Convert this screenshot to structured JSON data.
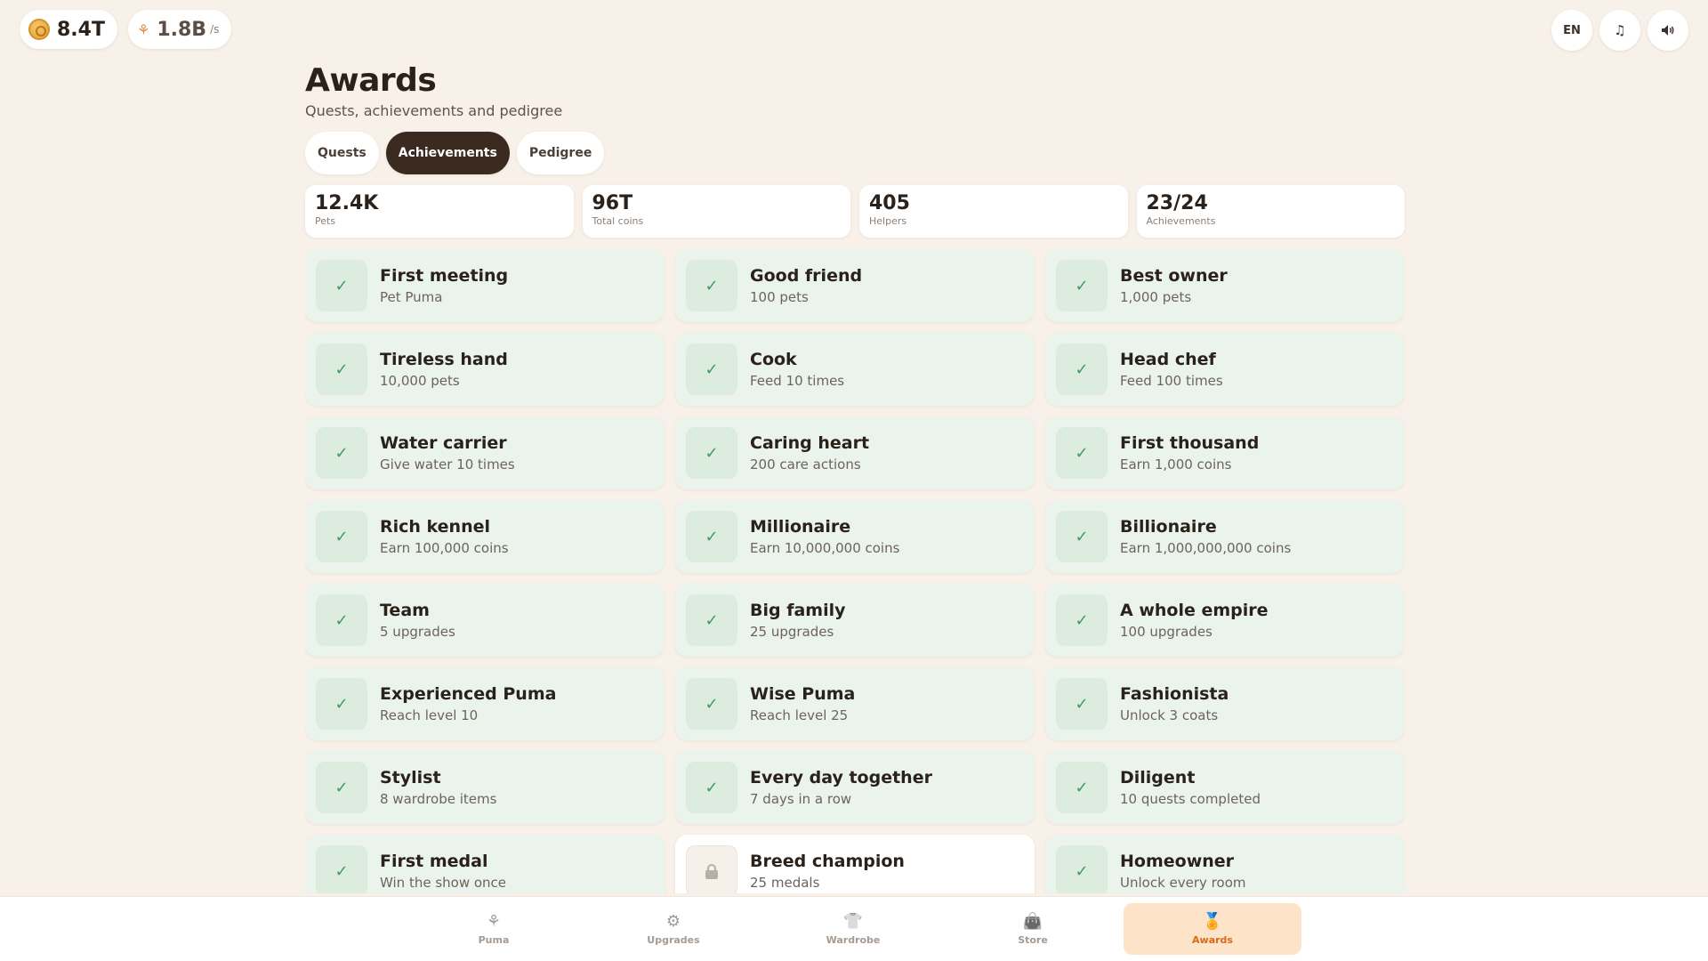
{
  "currency": {
    "coins": "8.4T",
    "rate": "1.8B",
    "rate_unit": "/s"
  },
  "top_right": {
    "language": "EN",
    "music_icon": "music-note-icon",
    "sound_icon": "speaker-icon"
  },
  "page": {
    "title": "Awards",
    "subtitle": "Quests, achievements and pedigree"
  },
  "tabs": [
    {
      "label": "Quests",
      "active": false
    },
    {
      "label": "Achievements",
      "active": true
    },
    {
      "label": "Pedigree",
      "active": false
    }
  ],
  "stats": [
    {
      "value": "12.4K",
      "label": "Pets"
    },
    {
      "value": "96T",
      "label": "Total coins"
    },
    {
      "value": "405",
      "label": "Helpers"
    },
    {
      "value": "23/24",
      "label": "Achievements"
    }
  ],
  "achievements": [
    {
      "name": "First meeting",
      "desc": "Pet Puma",
      "done": true
    },
    {
      "name": "Good friend",
      "desc": "100 pets",
      "done": true
    },
    {
      "name": "Best owner",
      "desc": "1,000 pets",
      "done": true
    },
    {
      "name": "Tireless hand",
      "desc": "10,000 pets",
      "done": true
    },
    {
      "name": "Cook",
      "desc": "Feed 10 times",
      "done": true
    },
    {
      "name": "Head chef",
      "desc": "Feed 100 times",
      "done": true
    },
    {
      "name": "Water carrier",
      "desc": "Give water 10 times",
      "done": true
    },
    {
      "name": "Caring heart",
      "desc": "200 care actions",
      "done": true
    },
    {
      "name": "First thousand",
      "desc": "Earn 1,000 coins",
      "done": true
    },
    {
      "name": "Rich kennel",
      "desc": "Earn 100,000 coins",
      "done": true
    },
    {
      "name": "Millionaire",
      "desc": "Earn 10,000,000 coins",
      "done": true
    },
    {
      "name": "Billionaire",
      "desc": "Earn 1,000,000,000 coins",
      "done": true
    },
    {
      "name": "Team",
      "desc": "5 upgrades",
      "done": true
    },
    {
      "name": "Big family",
      "desc": "25 upgrades",
      "done": true
    },
    {
      "name": "A whole empire",
      "desc": "100 upgrades",
      "done": true
    },
    {
      "name": "Experienced Puma",
      "desc": "Reach level 10",
      "done": true
    },
    {
      "name": "Wise Puma",
      "desc": "Reach level 25",
      "done": true
    },
    {
      "name": "Fashionista",
      "desc": "Unlock 3 coats",
      "done": true
    },
    {
      "name": "Stylist",
      "desc": "8 wardrobe items",
      "done": true
    },
    {
      "name": "Every day together",
      "desc": "7 days in a row",
      "done": true
    },
    {
      "name": "Diligent",
      "desc": "10 quests completed",
      "done": true
    },
    {
      "name": "First medal",
      "desc": "Win the show once",
      "done": true
    },
    {
      "name": "Breed champion",
      "desc": "25 medals",
      "done": false
    },
    {
      "name": "Homeowner",
      "desc": "Unlock every room",
      "done": true
    }
  ],
  "bottom_nav": [
    {
      "label": "Puma",
      "icon": "paw-icon",
      "active": false
    },
    {
      "label": "Upgrades",
      "icon": "gear-icon",
      "active": false
    },
    {
      "label": "Wardrobe",
      "icon": "shirt-icon",
      "active": false
    },
    {
      "label": "Store",
      "icon": "shopping-bag-icon",
      "active": false
    },
    {
      "label": "Awards",
      "icon": "medal-icon",
      "active": true
    }
  ]
}
